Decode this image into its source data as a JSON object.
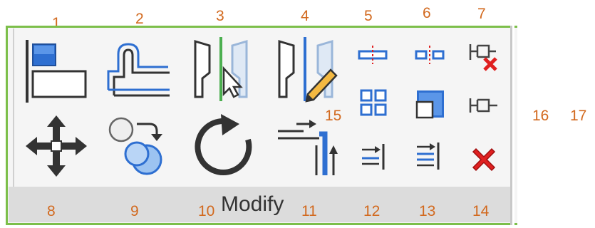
{
  "panel": {
    "title": "Modify"
  },
  "markers": {
    "n1": "1",
    "n2": "2",
    "n3": "3",
    "n4": "4",
    "n5": "5",
    "n6": "6",
    "n7": "7",
    "n8": "8",
    "n9": "9",
    "n10": "10",
    "n11": "11",
    "n12": "12",
    "n13": "13",
    "n14": "14",
    "n15": "15",
    "n16": "16",
    "n17": "17"
  },
  "tools": [
    {
      "id": "align",
      "icon": "align-icon"
    },
    {
      "id": "offset",
      "icon": "offset-icon"
    },
    {
      "id": "mirror-pick-axis",
      "icon": "mirror-pick-axis-icon"
    },
    {
      "id": "mirror-draw-axis",
      "icon": "mirror-draw-axis-icon"
    },
    {
      "id": "split-element",
      "icon": "split-element-icon"
    },
    {
      "id": "split-with-gap",
      "icon": "split-with-gap-icon"
    },
    {
      "id": "unpin",
      "icon": "unpin-icon"
    },
    {
      "id": "move",
      "icon": "move-icon"
    },
    {
      "id": "copy",
      "icon": "copy-icon"
    },
    {
      "id": "rotate",
      "icon": "rotate-icon"
    },
    {
      "id": "trim-extend-corner",
      "icon": "trim-extend-corner-icon"
    },
    {
      "id": "trim-extend-single",
      "icon": "trim-extend-single-icon"
    },
    {
      "id": "trim-extend-multiple",
      "icon": "trim-extend-multiple-icon"
    },
    {
      "id": "delete",
      "icon": "delete-icon"
    },
    {
      "id": "array",
      "icon": "array-icon"
    },
    {
      "id": "scale",
      "icon": "scale-icon"
    },
    {
      "id": "pin",
      "icon": "pin-icon"
    }
  ],
  "colors": {
    "accent_blue": "#2e6fd1",
    "number_orange": "#d2691e",
    "panel_green": "#7cbf4a",
    "delete_red": "#e02020"
  }
}
